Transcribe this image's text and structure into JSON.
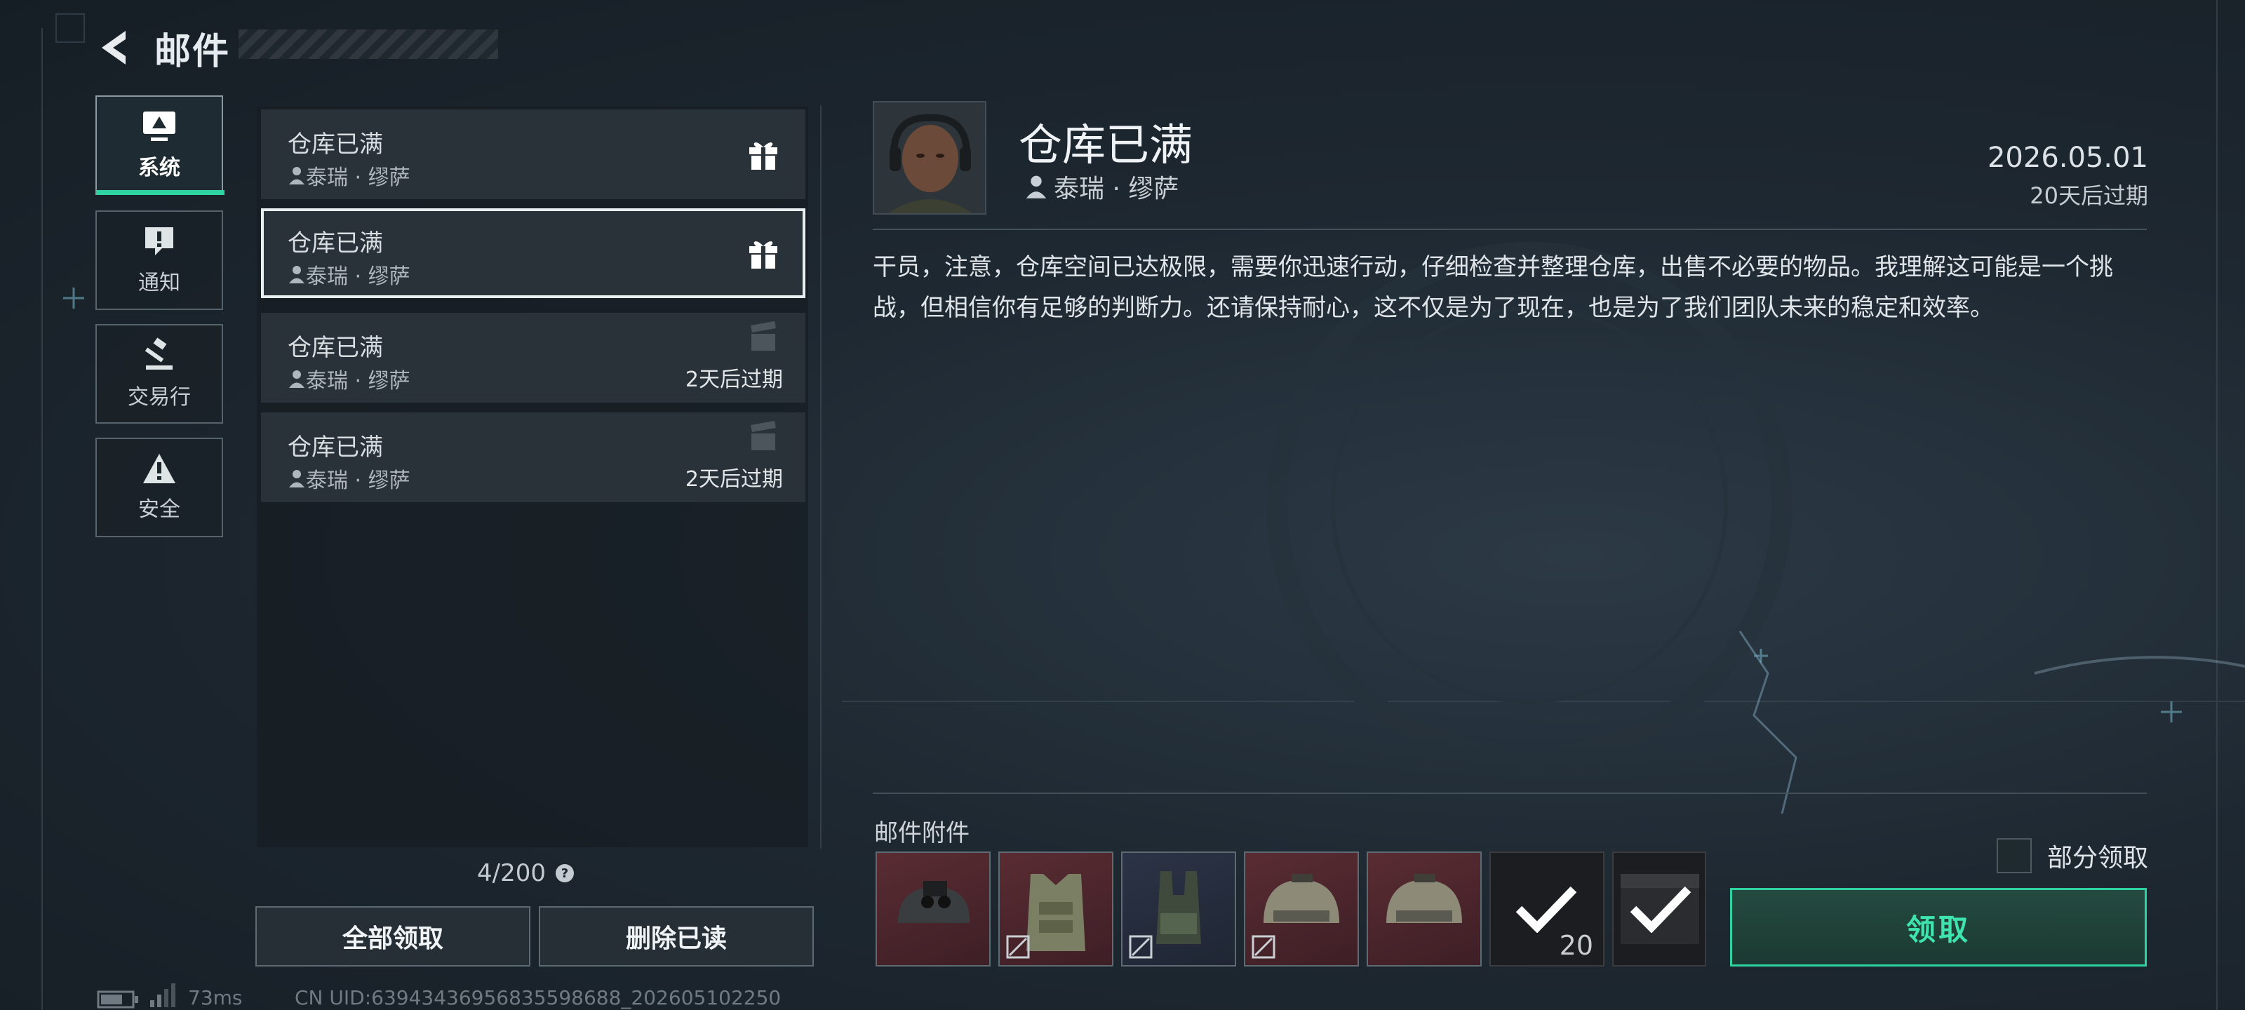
{
  "header": {
    "title": "邮件"
  },
  "categories": [
    {
      "label": "系统",
      "icon": "monitor-icon",
      "active": true
    },
    {
      "label": "通知",
      "icon": "alert-icon",
      "active": false
    },
    {
      "label": "交易行",
      "icon": "gavel-icon",
      "active": false
    },
    {
      "label": "安全",
      "icon": "warning-icon",
      "active": false
    }
  ],
  "mails": [
    {
      "title": "仓库已满",
      "sender": "泰瑞 · 缪萨",
      "expire": "",
      "gift_claimed": false,
      "selected": false
    },
    {
      "title": "仓库已满",
      "sender": "泰瑞 · 缪萨",
      "expire": "",
      "gift_claimed": false,
      "selected": true
    },
    {
      "title": "仓库已满",
      "sender": "泰瑞 · 缪萨",
      "expire": "2天后过期",
      "gift_claimed": true,
      "selected": false
    },
    {
      "title": "仓库已满",
      "sender": "泰瑞 · 缪萨",
      "expire": "2天后过期",
      "gift_claimed": true,
      "selected": false
    }
  ],
  "list": {
    "count": "4/200",
    "help": "?",
    "claim_all": "全部领取",
    "delete_read": "删除已读"
  },
  "footer": {
    "ping": "73ms",
    "uid": "CN UID:639434369568355986​88_202605102250"
  },
  "detail": {
    "title": "仓库已满",
    "sender": "泰瑞 · 缪萨",
    "date": "2026.05.01",
    "expire": "20天后过期",
    "body": "干员，注意，仓库空间已达极限，需要你迅速行动，仔细检查并整理仓库，出售不必要的物品。我理解这可能是一个挑战，但相信你有足够的判断力。还请保持耐心，这不仅是为了现在，也是为了我们团队未来的稳定和效率。"
  },
  "attachments": {
    "label": "邮件附件",
    "items": [
      {
        "icon": "night-vision-helmet-icon",
        "bound": false,
        "claimed": false,
        "qty": ""
      },
      {
        "icon": "armor-vest-icon",
        "bound": true,
        "claimed": false,
        "qty": ""
      },
      {
        "icon": "chest-rig-icon",
        "bound": true,
        "claimed": false,
        "qty": ""
      },
      {
        "icon": "tactical-helmet-icon",
        "bound": true,
        "claimed": false,
        "qty": ""
      },
      {
        "icon": "tactical-helmet-icon",
        "bound": false,
        "claimed": false,
        "qty": ""
      },
      {
        "icon": "ammo-box-icon",
        "bound": false,
        "claimed": true,
        "qty": "20"
      },
      {
        "icon": "supply-crate-icon",
        "bound": false,
        "claimed": true,
        "qty": ""
      }
    ],
    "partial_claim": "部分领取",
    "claim": "领取"
  },
  "colors": {
    "accent": "#2fd3a0",
    "item_red": "#5a2c33",
    "item_blue": "#2b3346"
  }
}
